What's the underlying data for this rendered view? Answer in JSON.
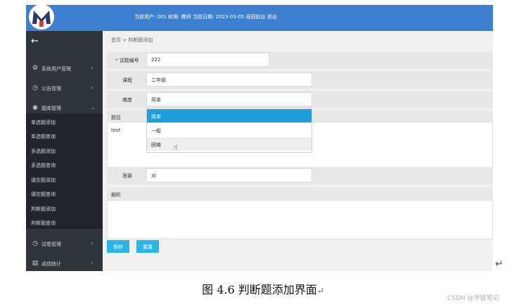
{
  "header": {
    "info": "当前用户: 001 权限: 教师 当前日期: 2023-03-05 返回前台 退出",
    "logo_text": "M"
  },
  "sidebar": {
    "back_icon": "arrow-left-icon",
    "menus": [
      {
        "label": "系统用户管理",
        "icon": "gear-icon"
      },
      {
        "label": "公告管理",
        "icon": "clock-icon"
      },
      {
        "label": "题库管理",
        "icon": "globe-icon"
      }
    ],
    "submenu": [
      "单选题添加",
      "单选题查询",
      "多选题添加",
      "多选题查询",
      "填空题添加",
      "填空题查询",
      "判断题添加",
      "判断题查询"
    ],
    "bottom_menus": [
      {
        "label": "试卷管理",
        "icon": "clock-icon"
      },
      {
        "label": "成绩统计",
        "icon": "chart-icon"
      }
    ]
  },
  "breadcrumb": "首页 > 判断题添加",
  "form": {
    "question_no_label": "试题编号",
    "question_no_required": "*",
    "question_no_value": "222",
    "course_label": "课程",
    "course_value": "二年级",
    "difficulty_label": "难度",
    "difficulty_value": "简单",
    "topic_label": "题目",
    "topic_value": "test",
    "answer_label": "答案",
    "answer_value": "对",
    "analysis_label": "解析"
  },
  "dropdown": {
    "options": [
      "简单",
      "一般",
      "困难"
    ],
    "selected_index": 0,
    "hover_index": 2
  },
  "buttons": {
    "save": "保存",
    "reset": "重置"
  },
  "caption": "图 4.6 判断题添加界面",
  "watermark": "CSDN @学徒笔记",
  "colors": {
    "header": "#3f7fcf",
    "sidebar": "#30343b",
    "accent": "#1e9fdc",
    "button": "#2bb5e4"
  }
}
